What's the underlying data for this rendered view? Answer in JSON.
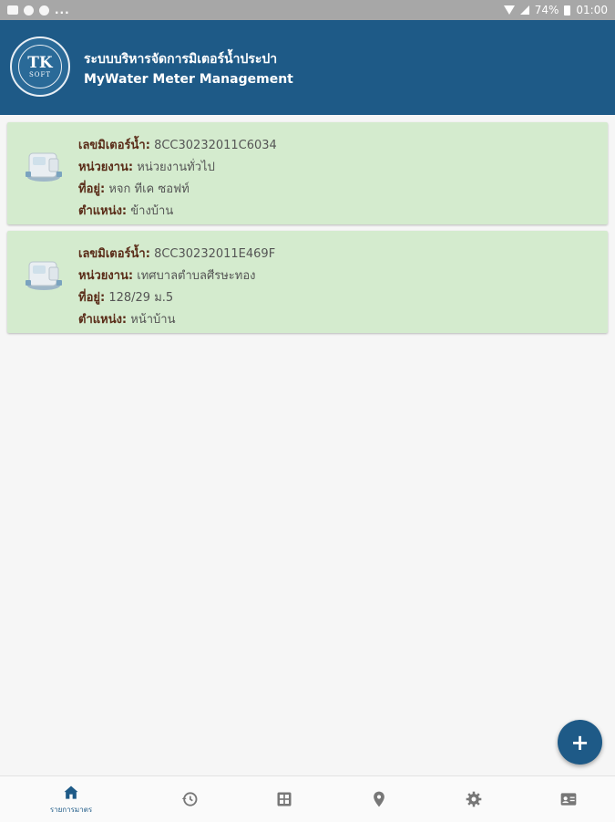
{
  "status_bar": {
    "notif_dots": "...",
    "battery": "74%",
    "time": "01:00"
  },
  "header": {
    "logo_text": "TK",
    "logo_sub": "SOFT",
    "title": "ระบบบริหารจัดการมิเตอร์น้ำประปา",
    "subtitle": "MyWater Meter Management"
  },
  "labels": {
    "meter_no": "เลขมิเตอร์น้ำ:",
    "unit": "หน่วยงาน:",
    "address": "ที่อยู่:",
    "position": "ตำแหน่ง:"
  },
  "meters": [
    {
      "meter_no": "8CC30232011C6034",
      "unit": "หน่วยงานทั่วไป",
      "address": "หจก ทีเค ซอฟท์",
      "position": "ข้างบ้าน"
    },
    {
      "meter_no": "8CC30232011E469F",
      "unit": "เทศบาลตำบลศีรษะทอง",
      "address": "128/29 ม.5",
      "position": "หน้าบ้าน"
    }
  ],
  "fab": {
    "label": "+"
  },
  "bottom_nav": {
    "home_label": "รายการมาตร",
    "icons": [
      "home-icon",
      "history-icon",
      "grid-icon",
      "location-pin-icon",
      "gear-icon",
      "contact-card-icon"
    ]
  },
  "colors": {
    "primary": "#1e5a87",
    "card_bg": "#d4ebce",
    "label": "#5a2c18"
  }
}
